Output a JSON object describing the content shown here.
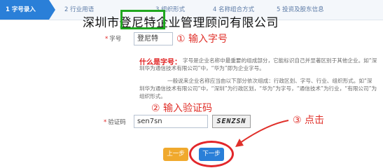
{
  "steps": [
    {
      "label": "1 字号录入"
    },
    {
      "label": "2 行业用语"
    },
    {
      "label": "3 组织形式"
    },
    {
      "label": "4 名称组合方式"
    },
    {
      "label": "5 投资及股东信息"
    }
  ],
  "overlay": {
    "company_name": "深圳市登尼特企业管理顾问有限公司",
    "annotation_1": "① 输入字号",
    "annotation_2": "② 输入验证码",
    "annotation_3": "③ 点击"
  },
  "form": {
    "name_label": "字号",
    "name_value": "登尼特",
    "what_title": "什么是字号：",
    "what_text_1": "字号是企业名称中最重要的组成部分，它能标识自己并显著区别于其他企业。如“深圳华为通信技术有限公司”中，“华为”即为企业字号。",
    "what_text_2": "一般说来企业名称应当由以下部分依次组成：行政区划、字号、行业、组织形式。如“深圳华为通信技术有限公司”中，“深圳”为行政区划，“华为”为字号，“通信技术”为行业，“有限公司”为组织形式。",
    "captcha_label": "验证码",
    "captcha_value": "sen7sn",
    "captcha_image_text": "SENZSN"
  },
  "buttons": {
    "prev": "上一步",
    "next": "下一步"
  },
  "colors": {
    "accent": "#2a7fd8",
    "prev_button": "#f0a92d",
    "annotation": "#e0302a",
    "highlight_box": "#1fa71f"
  }
}
